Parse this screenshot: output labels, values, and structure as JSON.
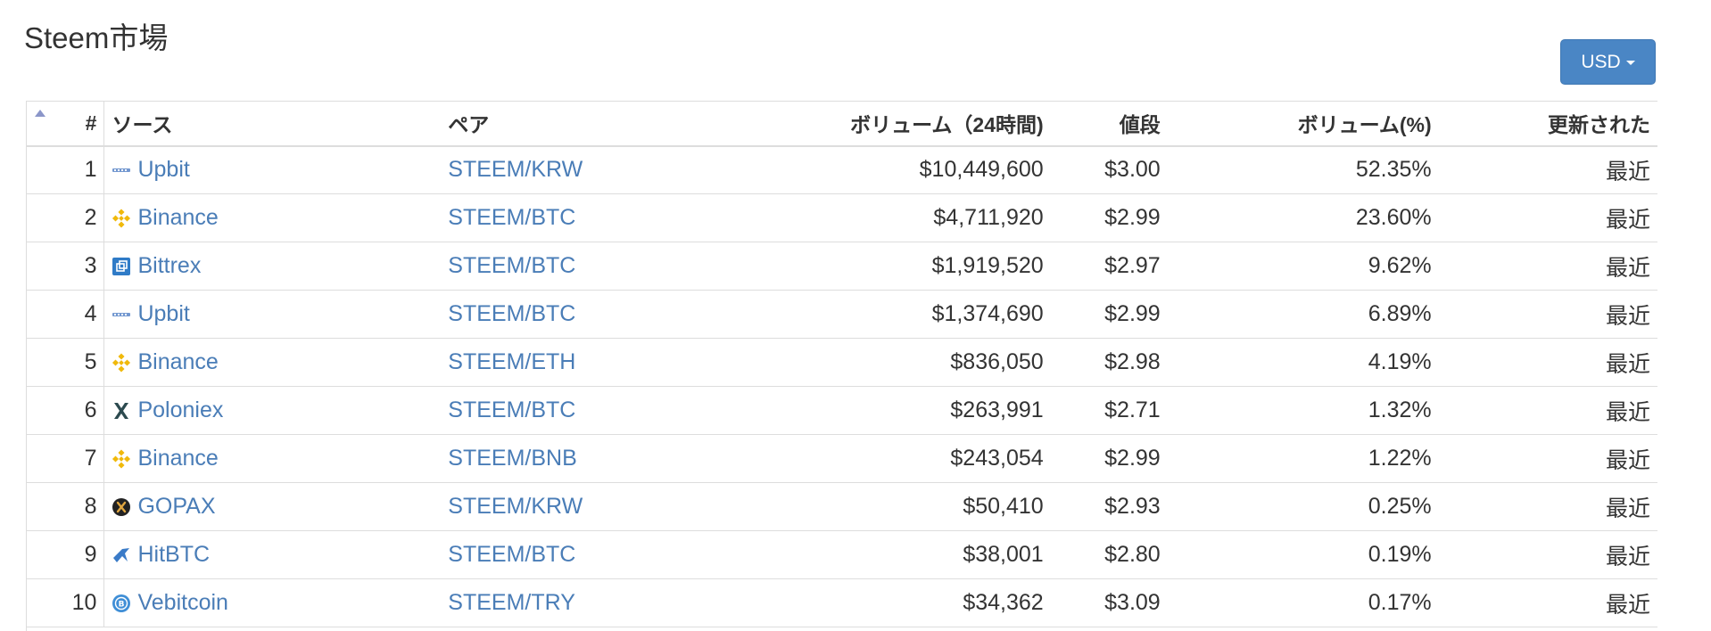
{
  "page": {
    "title": "Steem市場"
  },
  "currency": {
    "label": "USD"
  },
  "table": {
    "headers": {
      "num": "#",
      "source": "ソース",
      "pair": "ペア",
      "volume": "ボリューム（24時間)",
      "price": "値段",
      "volume_pct": "ボリューム(%)",
      "updated": "更新された"
    },
    "rows": [
      {
        "num": "1",
        "source": "Upbit",
        "icon": "upbit-icon",
        "pair": "STEEM/KRW",
        "volume": "$10,449,600",
        "price": "$3.00",
        "volume_pct": "52.35%",
        "updated": "最近"
      },
      {
        "num": "2",
        "source": "Binance",
        "icon": "binance-icon",
        "pair": "STEEM/BTC",
        "volume": "$4,711,920",
        "price": "$2.99",
        "volume_pct": "23.60%",
        "updated": "最近"
      },
      {
        "num": "3",
        "source": "Bittrex",
        "icon": "bittrex-icon",
        "pair": "STEEM/BTC",
        "volume": "$1,919,520",
        "price": "$2.97",
        "volume_pct": "9.62%",
        "updated": "最近"
      },
      {
        "num": "4",
        "source": "Upbit",
        "icon": "upbit-icon",
        "pair": "STEEM/BTC",
        "volume": "$1,374,690",
        "price": "$2.99",
        "volume_pct": "6.89%",
        "updated": "最近"
      },
      {
        "num": "5",
        "source": "Binance",
        "icon": "binance-icon",
        "pair": "STEEM/ETH",
        "volume": "$836,050",
        "price": "$2.98",
        "volume_pct": "4.19%",
        "updated": "最近"
      },
      {
        "num": "6",
        "source": "Poloniex",
        "icon": "poloniex-icon",
        "pair": "STEEM/BTC",
        "volume": "$263,991",
        "price": "$2.71",
        "volume_pct": "1.32%",
        "updated": "最近"
      },
      {
        "num": "7",
        "source": "Binance",
        "icon": "binance-icon",
        "pair": "STEEM/BNB",
        "volume": "$243,054",
        "price": "$2.99",
        "volume_pct": "1.22%",
        "updated": "最近"
      },
      {
        "num": "8",
        "source": "GOPAX",
        "icon": "gopax-icon",
        "pair": "STEEM/KRW",
        "volume": "$50,410",
        "price": "$2.93",
        "volume_pct": "0.25%",
        "updated": "最近"
      },
      {
        "num": "9",
        "source": "HitBTC",
        "icon": "hitbtc-icon",
        "pair": "STEEM/BTC",
        "volume": "$38,001",
        "price": "$2.80",
        "volume_pct": "0.19%",
        "updated": "最近"
      },
      {
        "num": "10",
        "source": "Vebitcoin",
        "icon": "vebitcoin-icon",
        "pair": "STEEM/TRY",
        "volume": "$34,362",
        "price": "$3.09",
        "volume_pct": "0.17%",
        "updated": "最近"
      }
    ]
  },
  "colors": {
    "link": "#4a7db7",
    "button": "#4a86c5",
    "binance": "#f0b90b",
    "bittrex": "#2f7bc7",
    "poloniex": "#2c4a4f",
    "gopax": "#222222",
    "hitbtc": "#3a7bc8",
    "vebitcoin": "#3f8ed6"
  }
}
